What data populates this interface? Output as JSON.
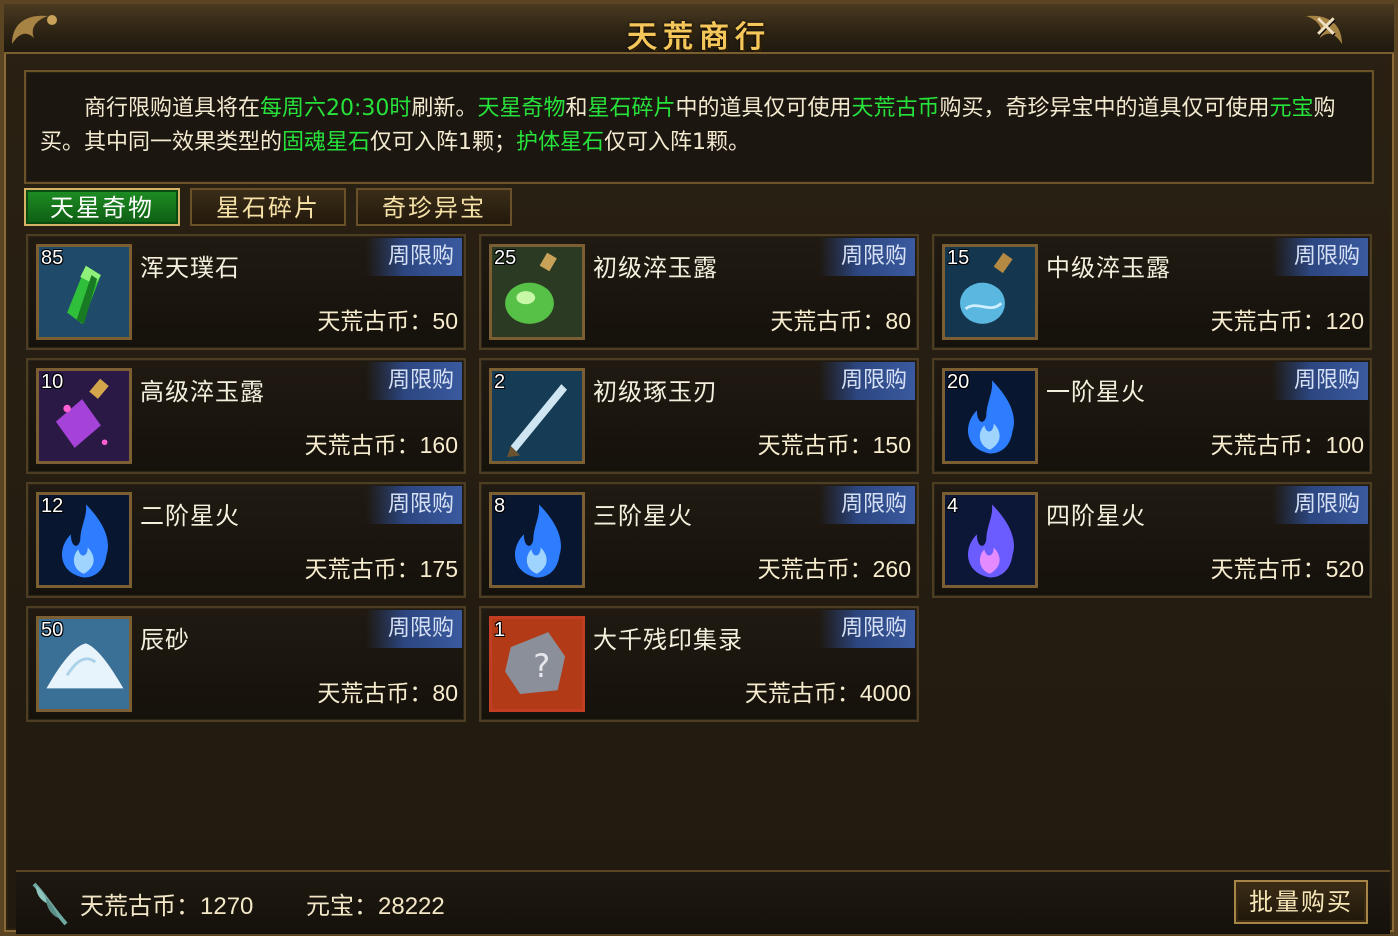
{
  "window": {
    "title": "天荒商行",
    "close_label": "✕"
  },
  "notice": {
    "parts": [
      {
        "t": "　　商行限购道具将在",
        "hl": false
      },
      {
        "t": "每周六20:30时",
        "hl": true
      },
      {
        "t": "刷新。",
        "hl": false
      },
      {
        "t": "天星奇物",
        "hl": true
      },
      {
        "t": "和",
        "hl": false
      },
      {
        "t": "星石碎片",
        "hl": true
      },
      {
        "t": "中的道具仅可使用",
        "hl": false
      },
      {
        "t": "天荒古币",
        "hl": true
      },
      {
        "t": "购买，奇珍异宝中的道具仅可使用",
        "hl": false
      },
      {
        "t": "元宝",
        "hl": true
      },
      {
        "t": "购买。其中同一效果类型的",
        "hl": false
      },
      {
        "t": "固魂星石",
        "hl": true
      },
      {
        "t": "仅可入阵1颗；",
        "hl": false
      },
      {
        "t": "护体星石",
        "hl": true
      },
      {
        "t": "仅可入阵1颗。",
        "hl": false
      }
    ],
    "highlight_color": "#27e23a"
  },
  "tabs": [
    {
      "label": "天星奇物",
      "active": true
    },
    {
      "label": "星石碎片",
      "active": false
    },
    {
      "label": "奇珍异宝",
      "active": false
    }
  ],
  "items": [
    {
      "qty": "85",
      "name": "浑天璞石",
      "badge": "周限购",
      "price_label": "天荒古币：",
      "price": "50",
      "icon": "green-crystal-icon"
    },
    {
      "qty": "25",
      "name": "初级淬玉露",
      "badge": "周限购",
      "price_label": "天荒古币：",
      "price": "80",
      "icon": "green-potion-icon"
    },
    {
      "qty": "15",
      "name": "中级淬玉露",
      "badge": "周限购",
      "price_label": "天荒古币：",
      "price": "120",
      "icon": "blue-potion-icon"
    },
    {
      "qty": "10",
      "name": "高级淬玉露",
      "badge": "周限购",
      "price_label": "天荒古币：",
      "price": "160",
      "icon": "purple-potion-icon"
    },
    {
      "qty": "2",
      "name": "初级琢玉刃",
      "badge": "周限购",
      "price_label": "天荒古币：",
      "price": "150",
      "icon": "jade-blade-icon"
    },
    {
      "qty": "20",
      "name": "一阶星火",
      "badge": "周限购",
      "price_label": "天荒古币：",
      "price": "100",
      "icon": "blue-flame-icon"
    },
    {
      "qty": "12",
      "name": "二阶星火",
      "badge": "周限购",
      "price_label": "天荒古币：",
      "price": "175",
      "icon": "blue-flame-icon"
    },
    {
      "qty": "8",
      "name": "三阶星火",
      "badge": "周限购",
      "price_label": "天荒古币：",
      "price": "260",
      "icon": "blue-flame-icon"
    },
    {
      "qty": "4",
      "name": "四阶星火",
      "badge": "周限购",
      "price_label": "天荒古币：",
      "price": "520",
      "icon": "purple-flame-icon"
    },
    {
      "qty": "50",
      "name": "辰砂",
      "badge": "周限购",
      "price_label": "天荒古币：",
      "price": "80",
      "icon": "cinnabar-powder-icon"
    },
    {
      "qty": "1",
      "name": "大千残印集录",
      "badge": "周限购",
      "price_label": "天荒古币：",
      "price": "4000",
      "icon": "mystery-seal-icon"
    }
  ],
  "footer": {
    "coin_label": "天荒古币：",
    "coin_value": "1270",
    "yuanbao_label": "元宝：",
    "yuanbao_value": "28222",
    "bulk_button": "批量购买"
  },
  "colors": {
    "title": "#f5c75b",
    "highlight": "#27e23a",
    "badge": "#2c4680"
  }
}
